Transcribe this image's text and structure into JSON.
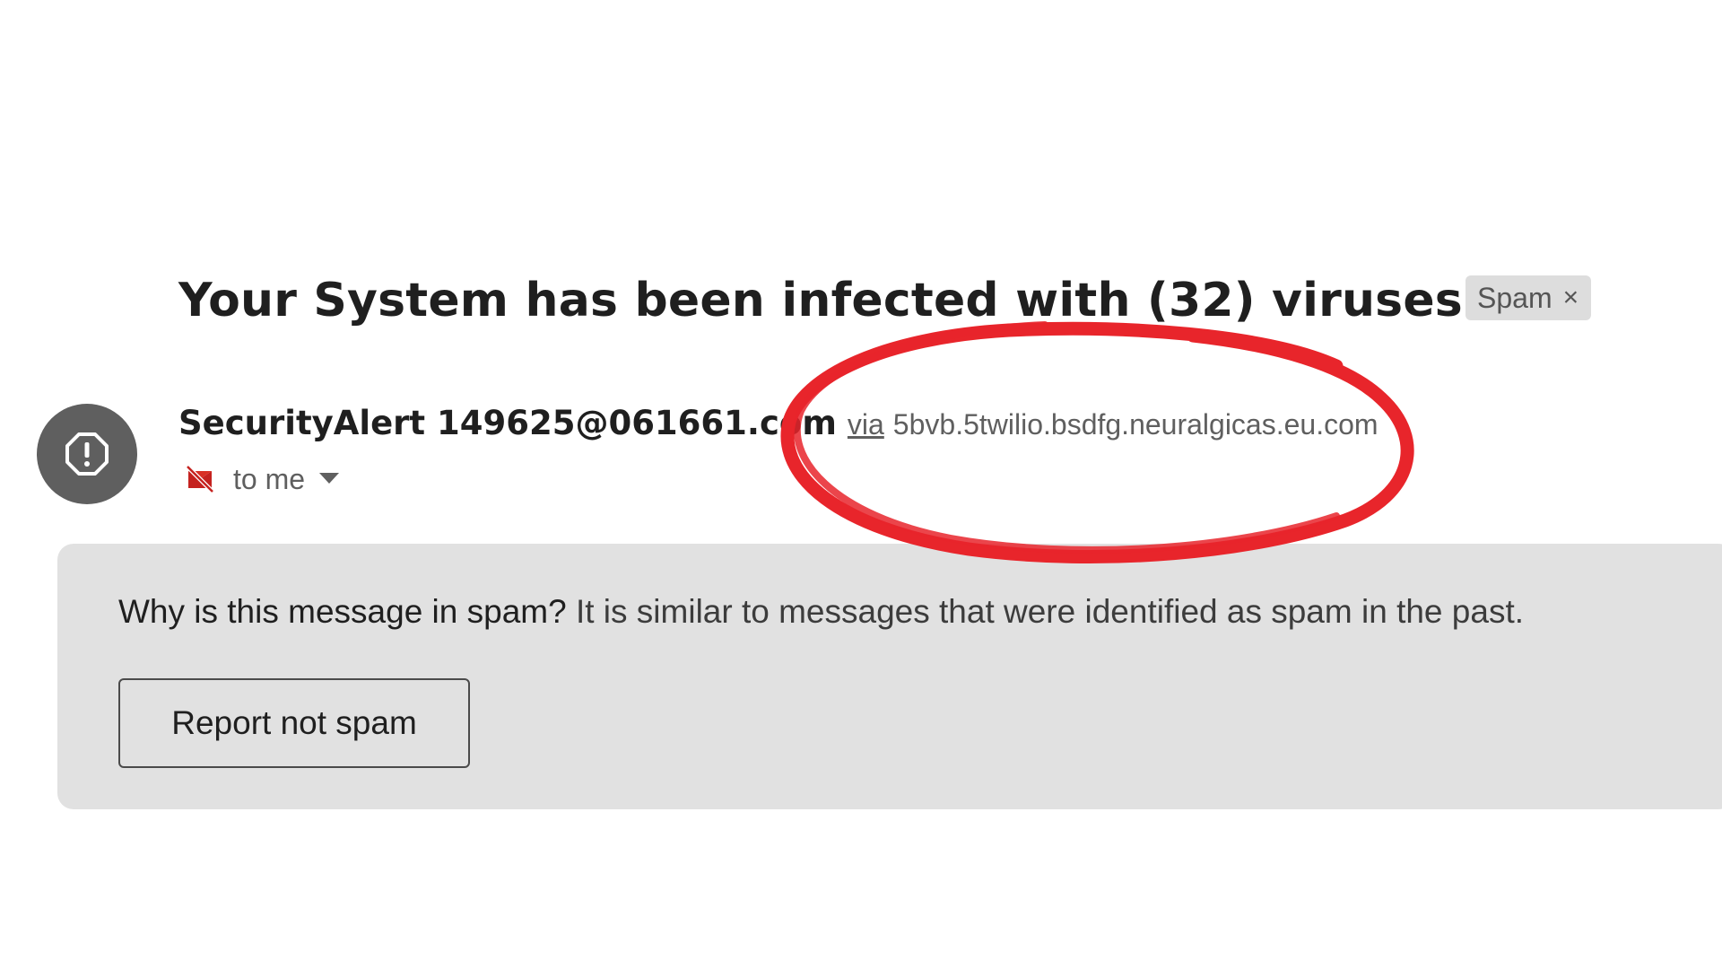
{
  "subject": {
    "text": "Your System has been infected with (32) viruses",
    "important_marker_icon": "important-marker-icon",
    "label_chip": "Spam",
    "label_chip_close": "×"
  },
  "sender": {
    "avatar_icon": "alert-icon",
    "name": "SecurityAlert 149625@061661.com",
    "via_label": "via",
    "via_domain": "5bvb.5twilio.bsdfg.neuralgicas.eu.com",
    "unverified_icon": "unverified-sender-icon",
    "recipient": "to me",
    "recipient_dropdown_icon": "chevron-down-icon"
  },
  "spam_notice": {
    "question": "Why is this message in spam?",
    "reason": "It is similar to messages that were identified as spam in the past.",
    "button_label": "Report not spam"
  },
  "annotation": {
    "shape": "hand-drawn circle",
    "color": "#e8252b"
  }
}
